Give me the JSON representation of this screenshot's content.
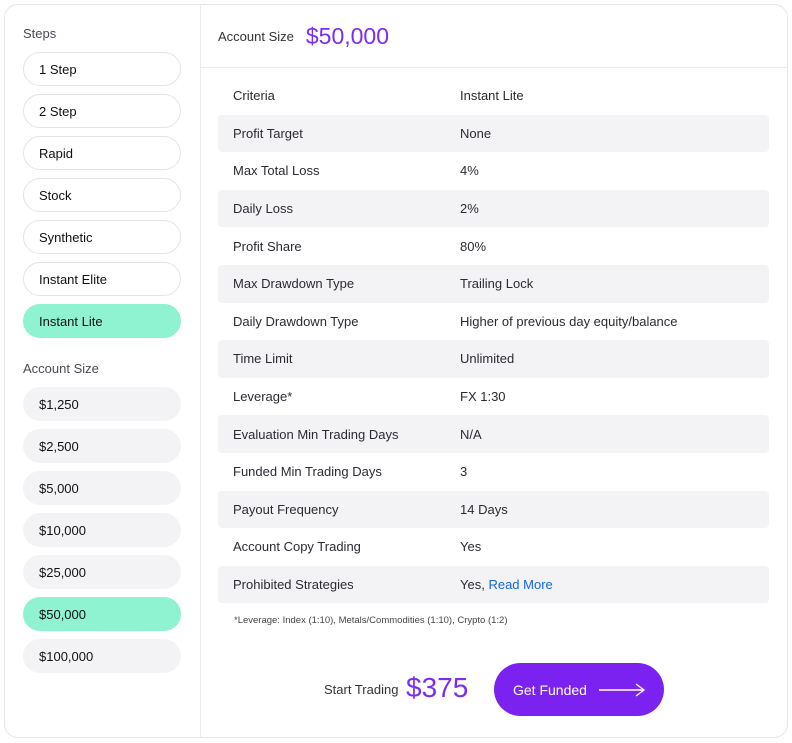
{
  "sidebar": {
    "steps_heading": "Steps",
    "steps": [
      {
        "label": "1 Step",
        "active": false
      },
      {
        "label": "2 Step",
        "active": false
      },
      {
        "label": "Rapid",
        "active": false
      },
      {
        "label": "Stock",
        "active": false
      },
      {
        "label": "Synthetic",
        "active": false
      },
      {
        "label": "Instant Elite",
        "active": false
      },
      {
        "label": "Instant Lite",
        "active": true
      }
    ],
    "size_heading": "Account Size",
    "sizes": [
      {
        "label": "$1,250",
        "active": false
      },
      {
        "label": "$2,500",
        "active": false
      },
      {
        "label": "$5,000",
        "active": false
      },
      {
        "label": "$10,000",
        "active": false
      },
      {
        "label": "$25,000",
        "active": false
      },
      {
        "label": "$50,000",
        "active": true
      },
      {
        "label": "$100,000",
        "active": false
      }
    ]
  },
  "header": {
    "label": "Account Size",
    "value": "$50,000"
  },
  "table": {
    "rows": [
      {
        "label": "Criteria",
        "value": "Instant Lite"
      },
      {
        "label": "Profit Target",
        "value": "None"
      },
      {
        "label": "Max Total Loss",
        "value": "4%"
      },
      {
        "label": "Daily Loss",
        "value": "2%"
      },
      {
        "label": "Profit Share",
        "value": "80%"
      },
      {
        "label": "Max Drawdown Type",
        "value": "Trailing Lock"
      },
      {
        "label": "Daily Drawdown Type",
        "value": "Higher of previous day equity/balance"
      },
      {
        "label": "Time Limit",
        "value": "Unlimited"
      },
      {
        "label": "Leverage*",
        "value": "FX 1:30"
      },
      {
        "label": "Evaluation Min Trading Days",
        "value": "N/A"
      },
      {
        "label": "Funded Min Trading Days",
        "value": "3"
      },
      {
        "label": "Payout Frequency",
        "value": "14 Days"
      },
      {
        "label": "Account Copy Trading",
        "value": "Yes"
      },
      {
        "label": "Prohibited Strategies",
        "value": "Yes,",
        "link": "Read More"
      }
    ]
  },
  "footnote": "*Leverage: Index (1:10), Metals/Commodities (1:10), Crypto (1:2)",
  "footer": {
    "start_label": "Start Trading",
    "price": "$375",
    "cta_label": "Get Funded",
    "cta_icon": "arrow-right-icon"
  },
  "colors": {
    "accent": "#7b22f0",
    "price": "#7b2cf5",
    "active_pill": "#8ff2d0",
    "link": "#1565e0"
  }
}
